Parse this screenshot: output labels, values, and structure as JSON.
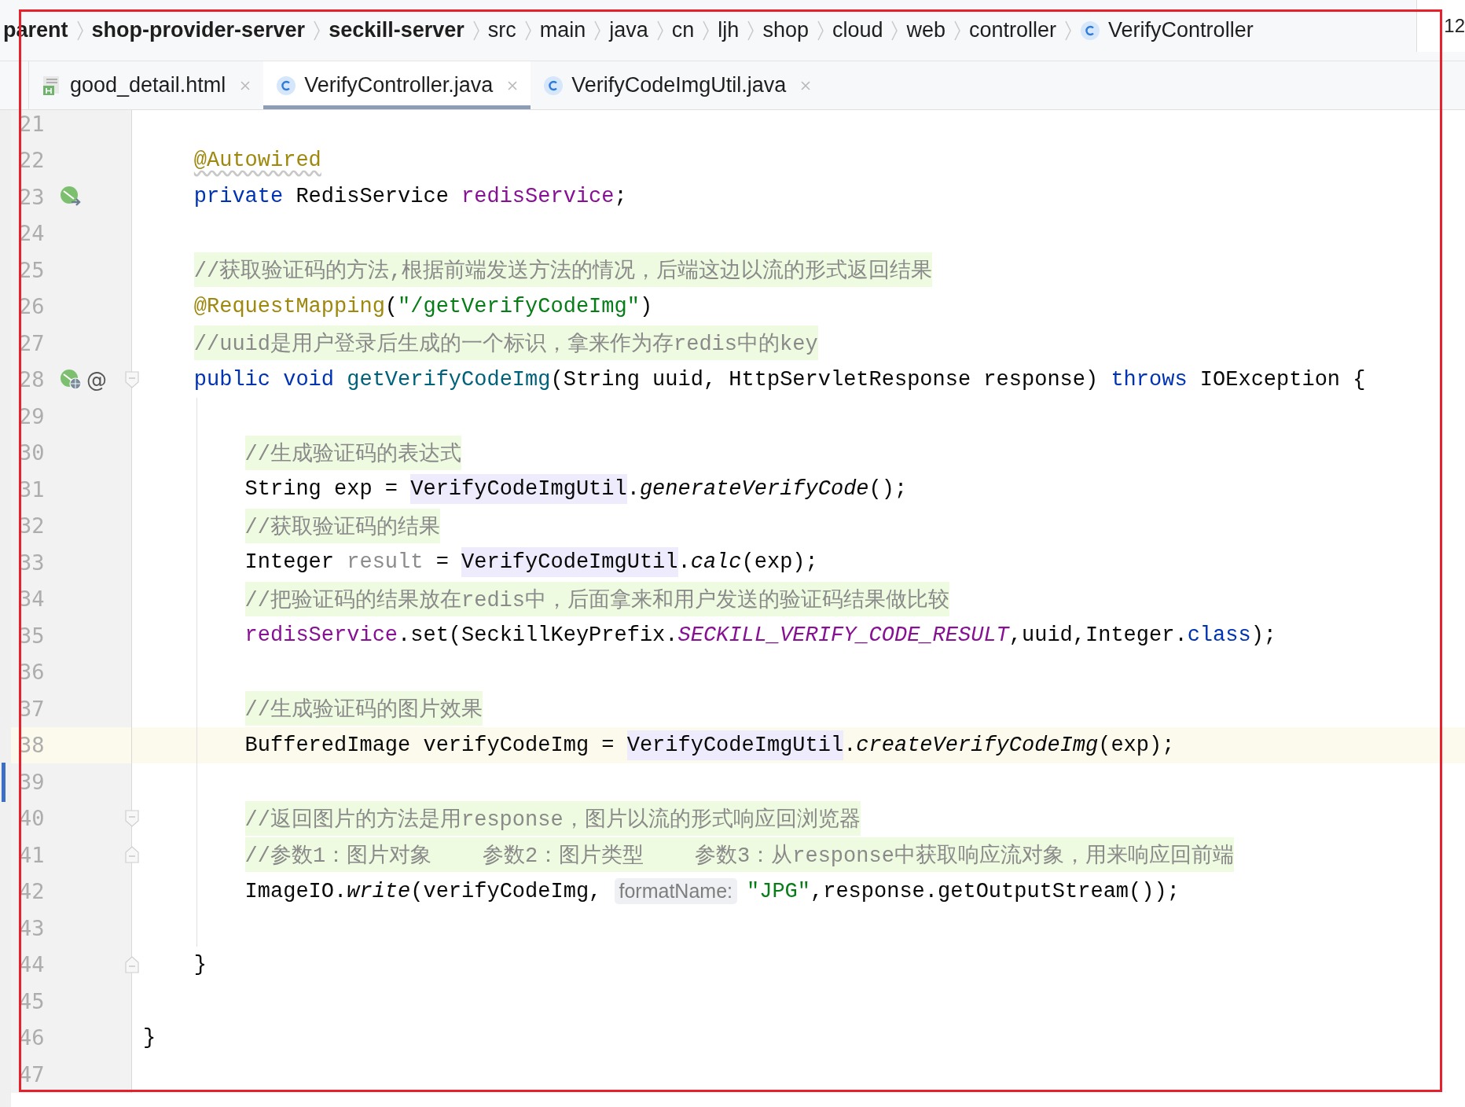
{
  "breadcrumbs": [
    {
      "label": "parent",
      "bold": true,
      "kind": "folder"
    },
    {
      "label": "shop-provider-server",
      "bold": true,
      "kind": "folder"
    },
    {
      "label": "seckill-server",
      "bold": true,
      "kind": "folder"
    },
    {
      "label": "src",
      "bold": false,
      "kind": "folder"
    },
    {
      "label": "main",
      "bold": false,
      "kind": "folder"
    },
    {
      "label": "java",
      "bold": false,
      "kind": "folder"
    },
    {
      "label": "cn",
      "bold": false,
      "kind": "folder"
    },
    {
      "label": "ljh",
      "bold": false,
      "kind": "folder"
    },
    {
      "label": "shop",
      "bold": false,
      "kind": "folder"
    },
    {
      "label": "cloud",
      "bold": false,
      "kind": "folder"
    },
    {
      "label": "web",
      "bold": false,
      "kind": "folder"
    },
    {
      "label": "controller",
      "bold": false,
      "kind": "folder"
    },
    {
      "label": "VerifyController",
      "bold": false,
      "kind": "class"
    }
  ],
  "side_label": "12",
  "tabs": [
    {
      "label": "good_detail.html",
      "kind": "html",
      "selected": false
    },
    {
      "label": "VerifyController.java",
      "kind": "class",
      "selected": true
    },
    {
      "label": "VerifyCodeImgUtil.java",
      "kind": "class",
      "selected": false
    }
  ],
  "editor": {
    "lines": [
      {
        "kind": "block",
        "children": [
          {
            "kind": "line",
            "number": "21"
          },
          {
            "kind": "line",
            "number": "22",
            "tokens": [
              {
                "kind": "annotation",
                "text": "@Autowired",
                "warning": true
              }
            ]
          },
          {
            "kind": "line",
            "number": "23",
            "marks": [
              {
                "kind": "bean"
              }
            ],
            "tokens": [
              {
                "kind": "keyword",
                "text": "private"
              },
              {
                "kind": "plain",
                "text": " RedisService "
              },
              {
                "kind": "field",
                "text": "redisService"
              },
              {
                "kind": "plain",
                "text": ";"
              }
            ]
          },
          {
            "kind": "line",
            "number": "24"
          },
          {
            "kind": "line",
            "number": "25",
            "tokens": [
              {
                "kind": "comment",
                "text": "//获取验证码的方法,根据前端发送方法的情况，后端这边以流的形式返回结果"
              }
            ]
          },
          {
            "kind": "line",
            "number": "26",
            "tokens": [
              {
                "kind": "annotation",
                "text": "@RequestMapping",
                "warning": false
              },
              {
                "kind": "plain",
                "text": "("
              },
              {
                "kind": "string",
                "text": "\"/getVerifyCodeImg\""
              },
              {
                "kind": "plain",
                "text": ")"
              }
            ]
          },
          {
            "kind": "line",
            "number": "27",
            "tokens": [
              {
                "kind": "comment",
                "text": "//uuid是用户登录后生成的一个标识，拿来作为存redis中的key"
              }
            ]
          },
          {
            "kind": "line",
            "number": "28",
            "fold": {
              "kind": "start"
            },
            "marks": [
              {
                "kind": "endpoint"
              },
              {
                "kind": "symbol",
                "text": "@"
              }
            ],
            "tokens": [
              {
                "kind": "keyword",
                "text": "public"
              },
              {
                "kind": "keyword",
                "text": "void"
              },
              {
                "kind": "method",
                "text": "getVerifyCodeImg"
              },
              {
                "kind": "plain",
                "text": "(String uuid, HttpServletResponse response) "
              },
              {
                "kind": "keyword",
                "text": "throws"
              },
              {
                "kind": "plain",
                "text": " IOException {"
              }
            ],
            "children": [
              {
                "kind": "line",
                "number": "29"
              },
              {
                "kind": "line",
                "number": "30",
                "tokens": [
                  {
                    "kind": "comment",
                    "text": "//生成验证码的表达式"
                  }
                ]
              },
              {
                "kind": "line",
                "number": "31",
                "tokens": [
                  {
                    "kind": "plain",
                    "text": "String exp = "
                  },
                  {
                    "kind": "classref",
                    "text": "VerifyCodeImgUtil"
                  },
                  {
                    "kind": "plain",
                    "text": "."
                  },
                  {
                    "kind": "static",
                    "text": "generateVerifyCode"
                  },
                  {
                    "kind": "plain",
                    "text": "();"
                  }
                ]
              },
              {
                "kind": "line",
                "number": "32",
                "tokens": [
                  {
                    "kind": "comment",
                    "text": "//获取验证码的结果"
                  }
                ]
              },
              {
                "kind": "line",
                "number": "33",
                "tokens": [
                  {
                    "kind": "plain",
                    "text": "Integer "
                  },
                  {
                    "kind": "unused",
                    "text": "result"
                  },
                  {
                    "kind": "plain",
                    "text": " = "
                  },
                  {
                    "kind": "classref",
                    "text": "VerifyCodeImgUtil"
                  },
                  {
                    "kind": "plain",
                    "text": "."
                  },
                  {
                    "kind": "static",
                    "text": "calc"
                  },
                  {
                    "kind": "plain",
                    "text": "(exp);"
                  }
                ]
              },
              {
                "kind": "line",
                "number": "34",
                "tokens": [
                  {
                    "kind": "comment",
                    "text": "//把验证码的结果放在redis中，后面拿来和用户发送的验证码结果做比较"
                  }
                ]
              },
              {
                "kind": "line",
                "number": "35",
                "tokens": [
                  {
                    "kind": "field",
                    "text": "redisService"
                  },
                  {
                    "kind": "plain",
                    "text": ".set(SeckillKeyPrefix."
                  },
                  {
                    "kind": "constant",
                    "text": "SECKILL_VERIFY_CODE_RESULT"
                  },
                  {
                    "kind": "plain",
                    "text": ",uuid,Integer."
                  },
                  {
                    "kind": "keyword",
                    "text": "class"
                  },
                  {
                    "kind": "plain",
                    "text": ");"
                  }
                ]
              },
              {
                "kind": "line",
                "number": "36"
              },
              {
                "kind": "line",
                "number": "37",
                "tokens": [
                  {
                    "kind": "comment",
                    "text": "//生成验证码的图片效果"
                  }
                ]
              },
              {
                "kind": "line",
                "number": "38",
                "current": true,
                "tokens": [
                  {
                    "kind": "plain",
                    "text": "BufferedImage verifyCodeImg = "
                  },
                  {
                    "kind": "classref",
                    "text": "VerifyCodeImgUtil"
                  },
                  {
                    "kind": "plain",
                    "text": "."
                  },
                  {
                    "kind": "static",
                    "text": "createVerifyCodeImg"
                  },
                  {
                    "kind": "plain",
                    "text": "(exp);"
                  }
                ]
              },
              {
                "kind": "line",
                "number": "39"
              },
              {
                "kind": "line",
                "number": "40",
                "fold": {
                  "kind": "start"
                },
                "tokens": [
                  {
                    "kind": "comment",
                    "text": "//返回图片的方法是用response，图片以流的形式响应回浏览器"
                  }
                ]
              },
              {
                "kind": "line",
                "number": "41",
                "fold": {
                  "kind": "end"
                },
                "tokens": [
                  {
                    "kind": "comment",
                    "text": "//参数1：图片对象    参数2：图片类型    参数3：从response中获取响应流对象，用来响应回前端"
                  }
                ]
              },
              {
                "kind": "line",
                "number": "42",
                "tokens": [
                  {
                    "kind": "plain",
                    "text": "ImageIO."
                  },
                  {
                    "kind": "static",
                    "text": "write"
                  },
                  {
                    "kind": "plain",
                    "text": "(verifyCodeImg, "
                  },
                  {
                    "kind": "hint",
                    "text": "formatName:"
                  },
                  {
                    "kind": "string",
                    "text": "\"JPG\""
                  },
                  {
                    "kind": "plain",
                    "text": ",response.getOutputStream());"
                  }
                ]
              },
              {
                "kind": "line",
                "number": "43"
              }
            ]
          },
          {
            "kind": "line",
            "number": "44",
            "fold": {
              "kind": "end"
            },
            "tokens": [
              {
                "kind": "plain",
                "text": "}"
              }
            ]
          },
          {
            "kind": "line",
            "number": "45"
          }
        ]
      },
      {
        "kind": "line",
        "number": "46",
        "tokens": [
          {
            "kind": "plain",
            "text": "}"
          }
        ]
      },
      {
        "kind": "line",
        "number": "47"
      }
    ]
  }
}
